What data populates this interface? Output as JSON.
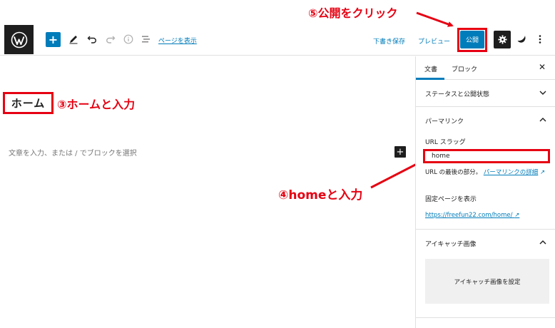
{
  "toolbar": {
    "page_details_link": "ページを表示",
    "save_draft": "下書き保存",
    "preview": "プレビュー",
    "publish": "公開"
  },
  "editor": {
    "title": "ホーム",
    "block_placeholder": "文章を入力、または / でブロックを選択"
  },
  "sidebar": {
    "tabs": [
      {
        "label": "文書",
        "active": true
      },
      {
        "label": "ブロック",
        "active": false
      }
    ],
    "status_panel": "ステータスと公開状態",
    "permalink_panel": "パーマリンク",
    "url_slug_label": "URL スラッグ",
    "url_slug_value": "home",
    "help_prefix": "URL の最後の部分。",
    "help_link": "パーマリンクの詳細",
    "view_page_label": "固定ページを表示",
    "page_url": "https://freefun22.com/home/",
    "featured_image_panel": "アイキャッチ画像",
    "featured_image_button": "アイキャッチ画像を設定"
  },
  "annotations": {
    "step3": "③ホームと入力",
    "step4": "④homeと入力",
    "step5": "⑤公開をクリック",
    "color": "#e60012"
  },
  "colors": {
    "accent": "#007cba",
    "dark": "#1e1e1e",
    "highlight": "#e60012"
  }
}
